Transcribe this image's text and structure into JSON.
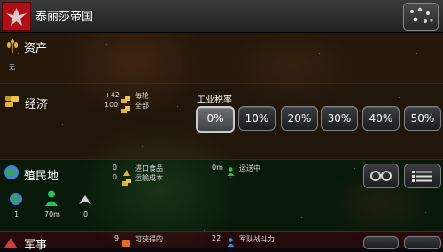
{
  "header": {
    "title": "泰丽莎帝国",
    "flag_icon": "empire-flag-icon",
    "galaxy_button_icon": "galaxy-icon"
  },
  "assets": {
    "title": "资产",
    "none_label": "无"
  },
  "economy": {
    "title": "经济",
    "per_turn_value": "+42",
    "per_turn_label": "每轮",
    "total_value": "100",
    "total_label": "全部",
    "tax_label": "工业税率",
    "tax_options": [
      "0%",
      "10%",
      "20%",
      "30%",
      "40%",
      "50%"
    ],
    "tax_selected": "0%"
  },
  "colonies": {
    "title": "殖民地",
    "import_food_value": "0",
    "import_food_label": "进口食品",
    "transport_cost_value": "0",
    "transport_cost_label": "运输成本",
    "in_transit_value": "0m",
    "in_transit_label": "运送中",
    "planets": "1",
    "population": "70m",
    "ships": "0"
  },
  "military": {
    "title": "军事",
    "available_value": "9",
    "available_label": "可获得的",
    "fleet_power_value": "22",
    "fleet_power_label": "军队战斗力"
  },
  "colors": {
    "flag": "#b10f17",
    "gold": "#e0b43a",
    "person": "#2fbf5a"
  }
}
